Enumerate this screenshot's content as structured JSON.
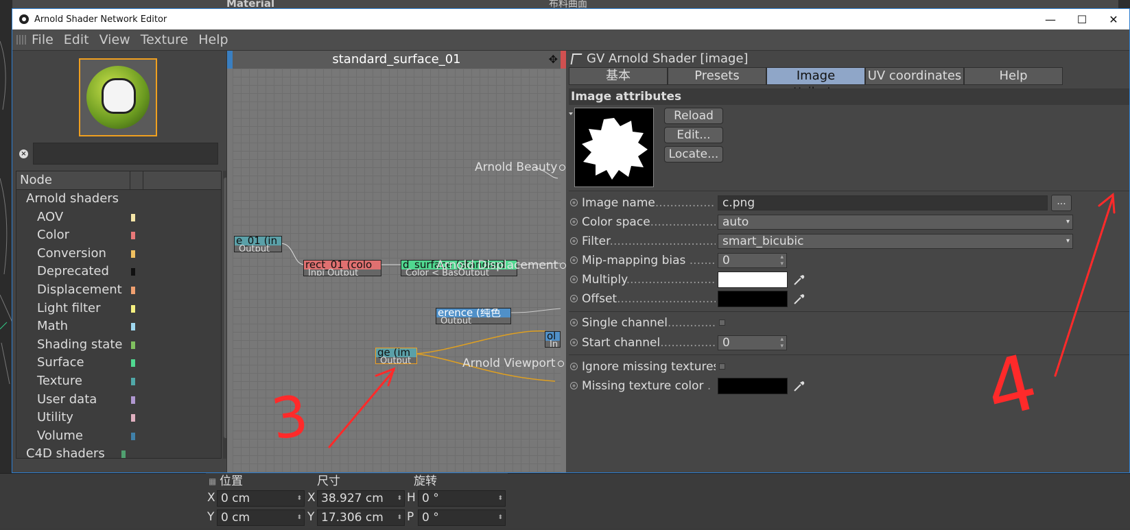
{
  "window": {
    "title": "Arnold Shader Network Editor",
    "controls": {
      "minimize": "—",
      "maximize": "☐",
      "close": "✕"
    }
  },
  "menu": [
    "File",
    "Edit",
    "View",
    "Texture",
    "Help"
  ],
  "node_list": {
    "header": "Node",
    "groups": [
      {
        "label": "Arnold shaders",
        "items": [
          {
            "label": "AOV",
            "color": "#f5e6a8"
          },
          {
            "label": "Color",
            "color": "#e87878"
          },
          {
            "label": "Conversion",
            "color": "#f0c060"
          },
          {
            "label": "Deprecated",
            "color": "#111111"
          },
          {
            "label": "Displacement",
            "color": "#f0a070"
          },
          {
            "label": "Light filter",
            "color": "#f5f080"
          },
          {
            "label": "Math",
            "color": "#a0d8f0"
          },
          {
            "label": "Shading state",
            "color": "#80c060"
          },
          {
            "label": "Surface",
            "color": "#50d890"
          },
          {
            "label": "Texture",
            "color": "#50a8a8"
          },
          {
            "label": "User data",
            "color": "#b098d0"
          },
          {
            "label": "Utility",
            "color": "#e0b0c0"
          },
          {
            "label": "Volume",
            "color": "#4080a8"
          }
        ]
      },
      {
        "label": "C4D shaders",
        "items": [],
        "color": "#50a070"
      }
    ]
  },
  "graph": {
    "title": "standard_surface_01",
    "nodes": [
      {
        "id": "n1",
        "title": "e_01 (in",
        "port": "Output",
        "color": "#5aa0a8"
      },
      {
        "id": "n2",
        "title": "rect_01 (colo",
        "port": "Inpi Output",
        "color": "#e07070"
      },
      {
        "id": "n3",
        "title": "d_surface (standard",
        "port": "Color < BasOutput",
        "color": "#50d890"
      },
      {
        "id": "n4",
        "title": "erence (纯色",
        "port": "Output",
        "color": "#5090c8"
      },
      {
        "id": "n5",
        "title": "ge (im",
        "port": "Output",
        "color": "#5aa0a8"
      },
      {
        "id": "n6",
        "title": "ol",
        "port": "In",
        "color": "#5090c8"
      }
    ],
    "connectors": {
      "beauty": "Arnold Beauty",
      "displacement": "Arnold Displacement",
      "viewport": "Arnold Viewport"
    }
  },
  "inspector": {
    "title": "GV Arnold Shader [image]",
    "tabs": [
      "基本",
      "Presets",
      "Image attributes",
      "UV coordinates",
      "Help"
    ],
    "active_tab": "Image attributes",
    "section": "Image attributes",
    "buttons": {
      "reload": "Reload",
      "edit": "Edit...",
      "locate": "Locate..."
    },
    "params": {
      "image_name": {
        "label": "Image name",
        "value": "c.png",
        "browse": "..."
      },
      "color_space": {
        "label": "Color space",
        "value": "auto"
      },
      "filter": {
        "label": "Filter",
        "value": "smart_bicubic"
      },
      "mip_bias": {
        "label": "Mip-mapping bias",
        "value": "0"
      },
      "multiply": {
        "label": "Multiply",
        "color": "#ffffff"
      },
      "offset": {
        "label": "Offset",
        "color": "#000000"
      },
      "single_channel": {
        "label": "Single channel"
      },
      "start_channel": {
        "label": "Start channel",
        "value": "0"
      },
      "ignore_missing": {
        "label": "Ignore missing textures"
      },
      "missing_color": {
        "label": "Missing texture color",
        "color": "#000000"
      }
    }
  },
  "coordinates": {
    "headers": {
      "position": "位置",
      "size": "尺寸",
      "rotation": "旋转"
    },
    "rows": [
      {
        "pos_axis": "X",
        "pos": "0 cm",
        "size_axis": "X",
        "size": "38.927 cm",
        "rot_axis": "H",
        "rot": "0 °"
      },
      {
        "pos_axis": "Y",
        "pos": "0 cm",
        "size_axis": "Y",
        "size": "17.306 cm",
        "rot_axis": "P",
        "rot": "0 °"
      }
    ]
  },
  "background": {
    "material_label": "Material",
    "object_label": "布料曲面"
  },
  "annotations": {
    "left": "3",
    "right": "4"
  }
}
